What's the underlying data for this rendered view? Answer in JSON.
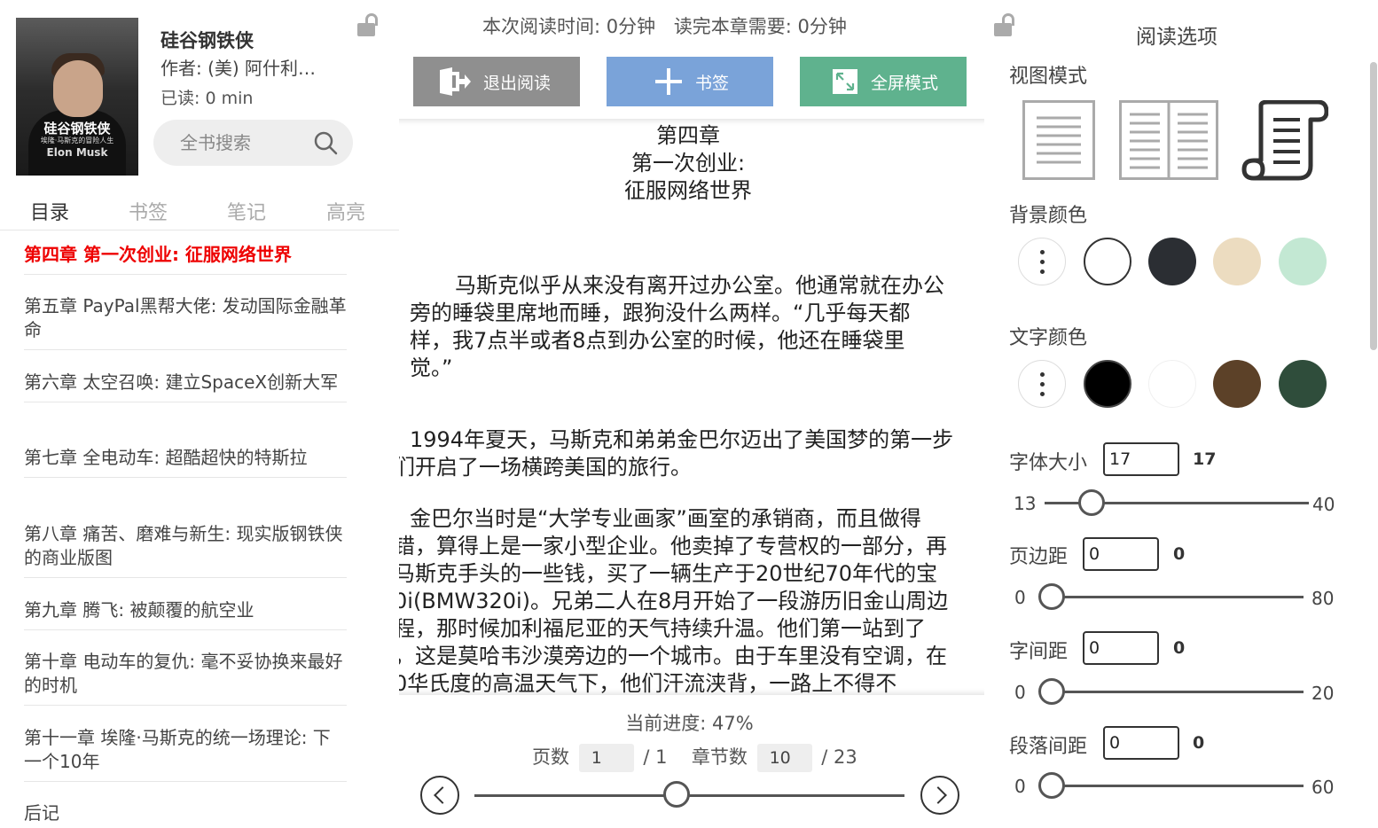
{
  "book": {
    "title": "硅谷钢铁侠",
    "author": "作者: (美) 阿什利…",
    "read": "已读: 0  min",
    "cover_title": "硅谷钢铁侠",
    "cover_subtitle": "埃隆·马斯克的冒险人生",
    "cover_name": "Elon Musk"
  },
  "search": {
    "placeholder": "全书搜索"
  },
  "tabs": [
    {
      "label": "目录",
      "active": true
    },
    {
      "label": "书签",
      "active": false
    },
    {
      "label": "笔记",
      "active": false
    },
    {
      "label": "高亮",
      "active": false
    }
  ],
  "toc": [
    {
      "label": "第四章 第一次创业:  征服网络世界",
      "current": true
    },
    {
      "label": "第五章 PayPal黑帮大佬:  发动国际金融革命",
      "current": false
    },
    {
      "label": "第六章 太空召唤:  建立SpaceX创新大军",
      "current": false
    },
    {
      "label": "第七章 全电动车:  超酷超快的特斯拉",
      "current": false
    },
    {
      "label": "第八章 痛苦、磨难与新生:  现实版钢铁侠的商业版图",
      "current": false
    },
    {
      "label": "第九章 腾飞:  被颠覆的航空业",
      "current": false
    },
    {
      "label": "第十章 电动车的复仇:  毫不妥协换来最好的时机",
      "current": false
    },
    {
      "label": "第十一章 埃隆·马斯克的统一场理论:  下一个10年",
      "current": false
    },
    {
      "label": "后记",
      "current": false
    }
  ],
  "topbar": {
    "reading_time": "本次阅读时间: 0分钟",
    "remaining_time": "读完本章需要: 0分钟",
    "exit_label": "退出阅读",
    "bookmark_label": "书签",
    "fullscreen_label": "全屏模式"
  },
  "chapter": {
    "line1": "第四章",
    "line2": "第一次创业:",
    "line3": "征服网络世界"
  },
  "content_lines": [
    "马斯克似乎从来没有离开过办公室。他通常就在办公",
    "旁的睡袋里席地而睡，跟狗没什么两样。“几乎每天都",
    "样，我7点半或者8点到办公室的时候，他还在睡袋里",
    "觉。”",
    "1994年夏天，马斯克和弟弟金巴尔迈出了美国梦的第一步",
    "们开启了一场横跨美国的旅行。",
    "金巴尔当时是“大学专业画家”画室的承销商，而且做得",
    "错，算得上是一家小型企业。他卖掉了专营权的一部分，再",
    "马斯克手头的一些钱，买了一辆生产于20世纪70年代的宝",
    "0i(BMW320i)。兄弟二人在8月开始了一段游历旧金山周边",
    "程，那时候加利福尼亚的天气持续升温。他们第一站到了",
    "，这是莫哈韦沙漠旁边的一个城市。由于车里没有空调，在",
    "0华氏度的高温天气下，他们汗流浃背，一路上不得不"
  ],
  "progress": {
    "text": "当前进度: 47%",
    "fraction": 0.47,
    "page_label": "页数",
    "page": "1",
    "page_total": "/ 1",
    "chapter_label": "章节数",
    "chapter_num": "10",
    "chapter_total": "/ 23"
  },
  "options": {
    "title": "阅读选项",
    "view_mode_label": "视图模式",
    "view_modes": [
      "single-page-icon",
      "double-page-icon",
      "scroll-icon"
    ],
    "bg_color_label": "背景颜色",
    "bg_colors": [
      "#ffffff",
      "#2b2e33",
      "#ecdcc0",
      "#c3e8d3"
    ],
    "text_color_label": "文字颜色",
    "text_colors": [
      "#000000",
      "#ffffff",
      "#5c4128",
      "#2f4d3b"
    ],
    "font_size": {
      "label": "字体大小",
      "value": "17",
      "display": "17",
      "min": "13",
      "max": "40"
    },
    "page_margin": {
      "label": "页边距",
      "value": "0",
      "display": "0",
      "min": "0",
      "max": "80"
    },
    "letter_spacing": {
      "label": "字间距",
      "value": "0",
      "display": "0",
      "min": "0",
      "max": "20"
    },
    "paragraph_spacing": {
      "label": "段落间距",
      "value": "0",
      "display": "0",
      "min": "0",
      "max": "60"
    }
  },
  "colors": {
    "accent_red": "#ee0000",
    "exit": "#8f8f8f",
    "bookmark": "#7aa3d9",
    "fullscreen": "#5fb28e"
  },
  "icons": [
    "lock-open-icon",
    "search-icon",
    "exit-icon",
    "plus-icon",
    "fullscreen-icon",
    "chevron-left-icon",
    "chevron-right-icon",
    "more-dots-icon"
  ]
}
